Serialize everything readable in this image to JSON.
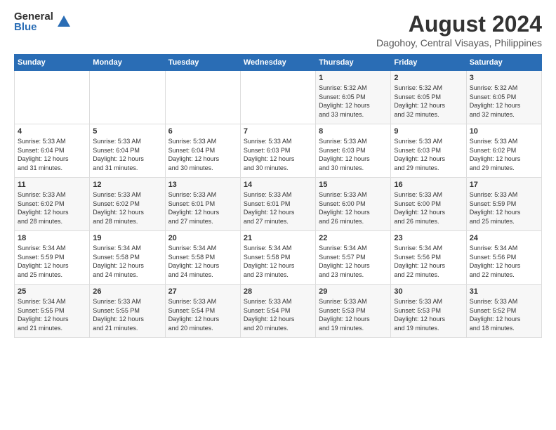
{
  "logo": {
    "general": "General",
    "blue": "Blue"
  },
  "title": "August 2024",
  "subtitle": "Dagohoy, Central Visayas, Philippines",
  "days_of_week": [
    "Sunday",
    "Monday",
    "Tuesday",
    "Wednesday",
    "Thursday",
    "Friday",
    "Saturday"
  ],
  "weeks": [
    [
      {
        "day": "",
        "info": ""
      },
      {
        "day": "",
        "info": ""
      },
      {
        "day": "",
        "info": ""
      },
      {
        "day": "",
        "info": ""
      },
      {
        "day": "1",
        "info": "Sunrise: 5:32 AM\nSunset: 6:05 PM\nDaylight: 12 hours\nand 33 minutes."
      },
      {
        "day": "2",
        "info": "Sunrise: 5:32 AM\nSunset: 6:05 PM\nDaylight: 12 hours\nand 32 minutes."
      },
      {
        "day": "3",
        "info": "Sunrise: 5:32 AM\nSunset: 6:05 PM\nDaylight: 12 hours\nand 32 minutes."
      }
    ],
    [
      {
        "day": "4",
        "info": "Sunrise: 5:33 AM\nSunset: 6:04 PM\nDaylight: 12 hours\nand 31 minutes."
      },
      {
        "day": "5",
        "info": "Sunrise: 5:33 AM\nSunset: 6:04 PM\nDaylight: 12 hours\nand 31 minutes."
      },
      {
        "day": "6",
        "info": "Sunrise: 5:33 AM\nSunset: 6:04 PM\nDaylight: 12 hours\nand 30 minutes."
      },
      {
        "day": "7",
        "info": "Sunrise: 5:33 AM\nSunset: 6:03 PM\nDaylight: 12 hours\nand 30 minutes."
      },
      {
        "day": "8",
        "info": "Sunrise: 5:33 AM\nSunset: 6:03 PM\nDaylight: 12 hours\nand 30 minutes."
      },
      {
        "day": "9",
        "info": "Sunrise: 5:33 AM\nSunset: 6:03 PM\nDaylight: 12 hours\nand 29 minutes."
      },
      {
        "day": "10",
        "info": "Sunrise: 5:33 AM\nSunset: 6:02 PM\nDaylight: 12 hours\nand 29 minutes."
      }
    ],
    [
      {
        "day": "11",
        "info": "Sunrise: 5:33 AM\nSunset: 6:02 PM\nDaylight: 12 hours\nand 28 minutes."
      },
      {
        "day": "12",
        "info": "Sunrise: 5:33 AM\nSunset: 6:02 PM\nDaylight: 12 hours\nand 28 minutes."
      },
      {
        "day": "13",
        "info": "Sunrise: 5:33 AM\nSunset: 6:01 PM\nDaylight: 12 hours\nand 27 minutes."
      },
      {
        "day": "14",
        "info": "Sunrise: 5:33 AM\nSunset: 6:01 PM\nDaylight: 12 hours\nand 27 minutes."
      },
      {
        "day": "15",
        "info": "Sunrise: 5:33 AM\nSunset: 6:00 PM\nDaylight: 12 hours\nand 26 minutes."
      },
      {
        "day": "16",
        "info": "Sunrise: 5:33 AM\nSunset: 6:00 PM\nDaylight: 12 hours\nand 26 minutes."
      },
      {
        "day": "17",
        "info": "Sunrise: 5:33 AM\nSunset: 5:59 PM\nDaylight: 12 hours\nand 25 minutes."
      }
    ],
    [
      {
        "day": "18",
        "info": "Sunrise: 5:34 AM\nSunset: 5:59 PM\nDaylight: 12 hours\nand 25 minutes."
      },
      {
        "day": "19",
        "info": "Sunrise: 5:34 AM\nSunset: 5:58 PM\nDaylight: 12 hours\nand 24 minutes."
      },
      {
        "day": "20",
        "info": "Sunrise: 5:34 AM\nSunset: 5:58 PM\nDaylight: 12 hours\nand 24 minutes."
      },
      {
        "day": "21",
        "info": "Sunrise: 5:34 AM\nSunset: 5:58 PM\nDaylight: 12 hours\nand 23 minutes."
      },
      {
        "day": "22",
        "info": "Sunrise: 5:34 AM\nSunset: 5:57 PM\nDaylight: 12 hours\nand 23 minutes."
      },
      {
        "day": "23",
        "info": "Sunrise: 5:34 AM\nSunset: 5:56 PM\nDaylight: 12 hours\nand 22 minutes."
      },
      {
        "day": "24",
        "info": "Sunrise: 5:34 AM\nSunset: 5:56 PM\nDaylight: 12 hours\nand 22 minutes."
      }
    ],
    [
      {
        "day": "25",
        "info": "Sunrise: 5:34 AM\nSunset: 5:55 PM\nDaylight: 12 hours\nand 21 minutes."
      },
      {
        "day": "26",
        "info": "Sunrise: 5:33 AM\nSunset: 5:55 PM\nDaylight: 12 hours\nand 21 minutes."
      },
      {
        "day": "27",
        "info": "Sunrise: 5:33 AM\nSunset: 5:54 PM\nDaylight: 12 hours\nand 20 minutes."
      },
      {
        "day": "28",
        "info": "Sunrise: 5:33 AM\nSunset: 5:54 PM\nDaylight: 12 hours\nand 20 minutes."
      },
      {
        "day": "29",
        "info": "Sunrise: 5:33 AM\nSunset: 5:53 PM\nDaylight: 12 hours\nand 19 minutes."
      },
      {
        "day": "30",
        "info": "Sunrise: 5:33 AM\nSunset: 5:53 PM\nDaylight: 12 hours\nand 19 minutes."
      },
      {
        "day": "31",
        "info": "Sunrise: 5:33 AM\nSunset: 5:52 PM\nDaylight: 12 hours\nand 18 minutes."
      }
    ]
  ]
}
